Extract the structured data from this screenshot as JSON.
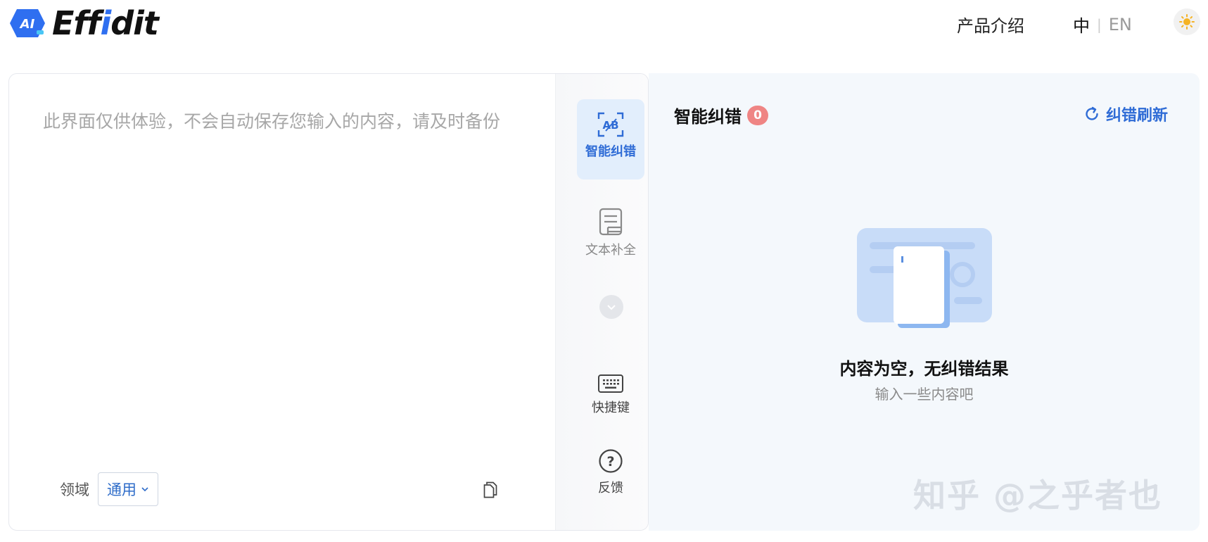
{
  "header": {
    "logo_text_pre": "Eff",
    "logo_text_i": "i",
    "logo_text_post": "dit",
    "logo_badge": "AI",
    "nav_intro": "产品介绍",
    "lang_zh": "中",
    "lang_separator": "|",
    "lang_en": "EN"
  },
  "editor": {
    "placeholder": "此界面仅供体验，不会自动保存您输入的内容，请及时备份",
    "domain_label": "领域",
    "domain_value": "通用"
  },
  "side_panel": {
    "correction_label": "智能纠错",
    "correction_icon_text": "AB",
    "completion_label": "文本补全",
    "shortcuts_label": "快捷键",
    "feedback_label": "反馈",
    "feedback_icon_text": "?"
  },
  "result": {
    "title": "智能纠错",
    "count": "0",
    "refresh_label": "纠错刷新",
    "empty_title": "内容为空，无纠错结果",
    "empty_subtitle": "输入一些内容吧"
  },
  "watermark": "知乎 @之乎者也",
  "colors": {
    "accent": "#2f6cd6",
    "badge": "#ef8584",
    "result_bg": "#f4f8fc",
    "active_tab_bg": "#e2eefc"
  }
}
